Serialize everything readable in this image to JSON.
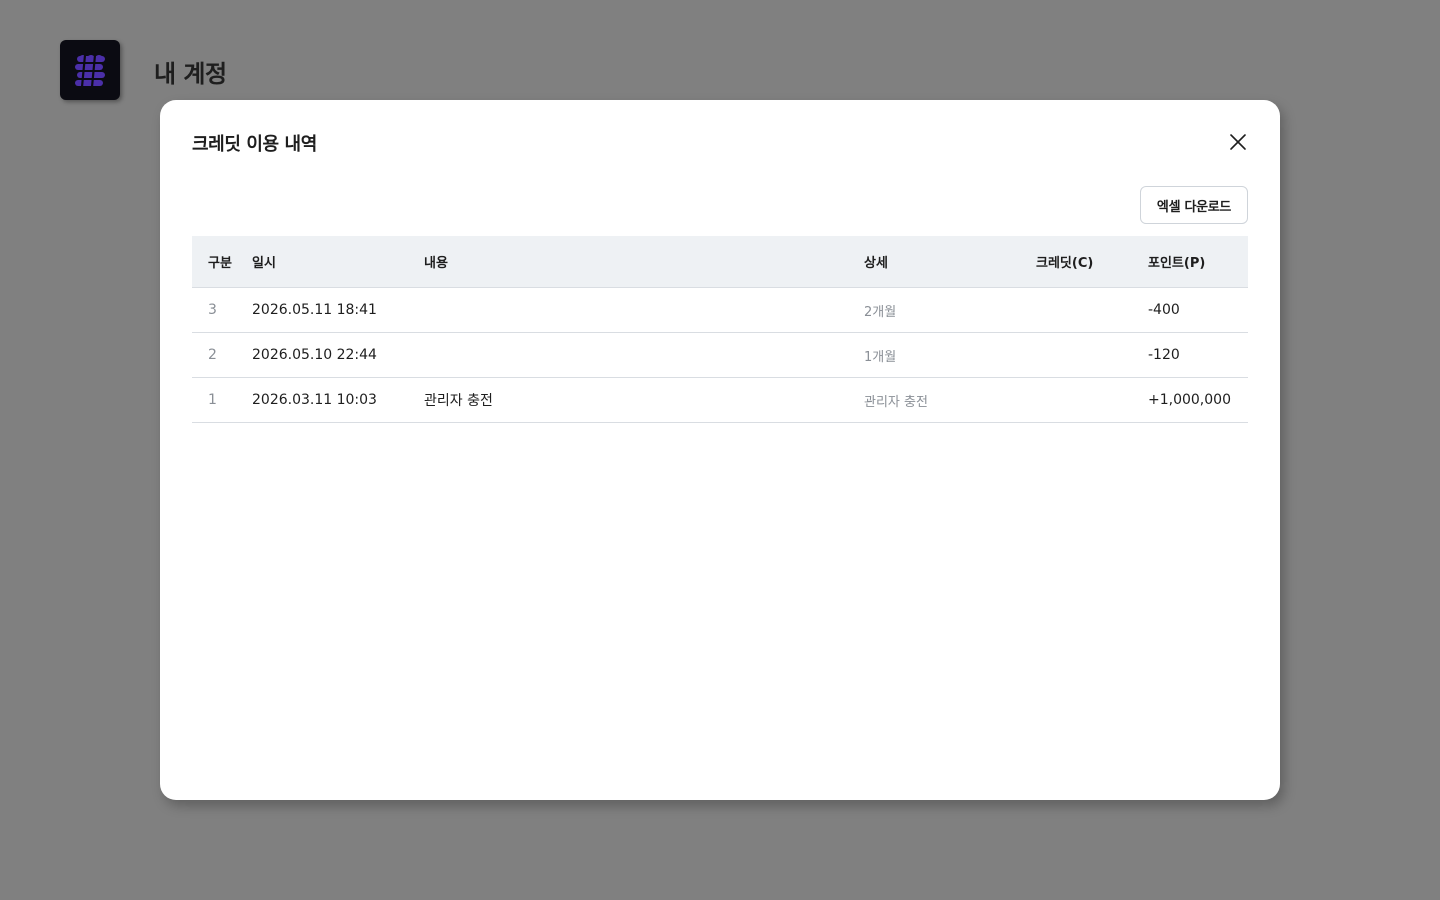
{
  "page": {
    "heading": "내 계정",
    "logo_icon": "app-logo-icon"
  },
  "modal": {
    "title": "크레딧 이용 내역",
    "close_icon": "close-icon",
    "excel_button_label": "엑셀 다운로드",
    "table": {
      "headers": {
        "no": "구분",
        "date": "일시",
        "content": "내용",
        "detail": "상세",
        "credit": "크레딧(C)",
        "point": "포인트(P)"
      },
      "rows": [
        {
          "no": "3",
          "date": "2026.05.11 18:41",
          "content": "",
          "detail": "2개월",
          "credit": "",
          "point": "-400"
        },
        {
          "no": "2",
          "date": "2026.05.10 22:44",
          "content": "",
          "detail": "1개월",
          "credit": "",
          "point": "-120"
        },
        {
          "no": "1",
          "date": "2026.03.11 10:03",
          "content": "관리자 충전",
          "detail": "관리자 충전",
          "credit": "",
          "point": "+1,000,000"
        }
      ]
    }
  },
  "colors": {
    "overlay": "#808080",
    "logo_bg": "#0b0b12",
    "logo_accent": "#4b2fa8",
    "table_header_bg": "#eef1f4"
  }
}
